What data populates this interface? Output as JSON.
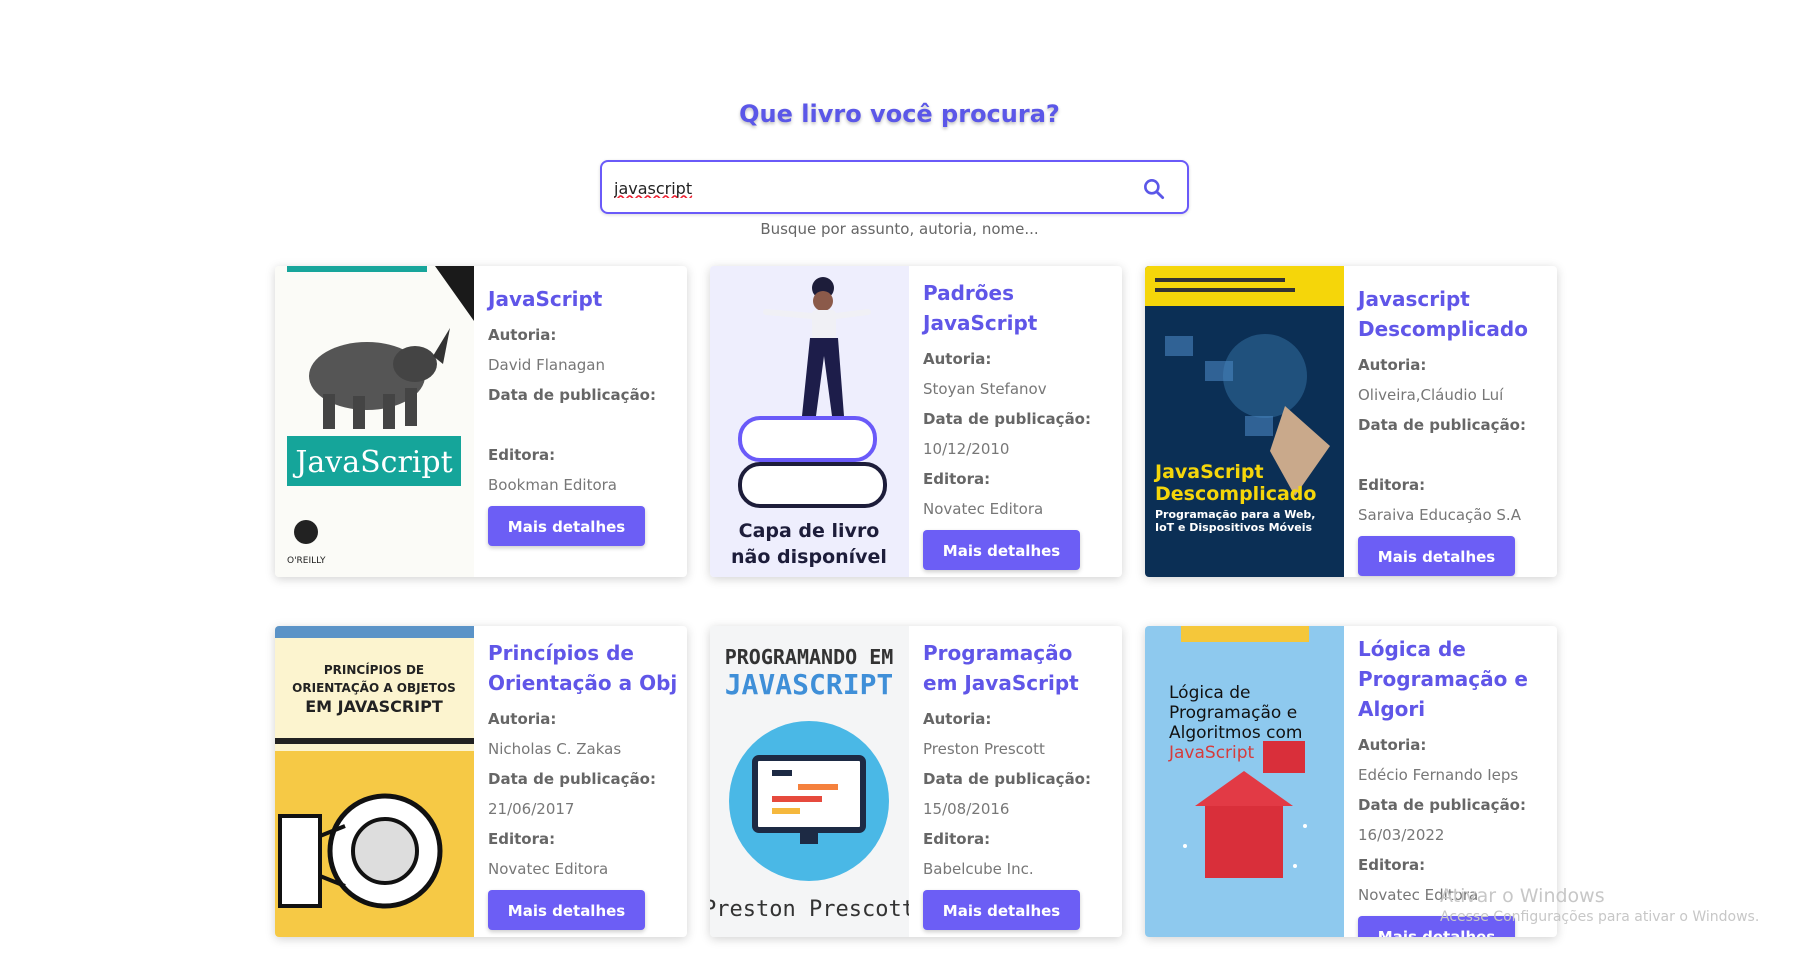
{
  "search": {
    "title": "Que livro você procura?",
    "value": "javascript",
    "hint": "Busque por assunto, autoria, nome..."
  },
  "labels": {
    "author": "Autoria:",
    "date": "Data de publicação:",
    "publisher": "Editora:",
    "button": "Mais detalhes"
  },
  "books": [
    {
      "title": "JavaScript",
      "author": "David Flanagan",
      "date": "",
      "publisher": "Bookman Editora",
      "cover": "javascript-guia-definitivo-cover"
    },
    {
      "title": "Padrões JavaScript",
      "author": "Stoyan Stefanov",
      "date": "10/12/2010",
      "publisher": "Novatec Editora",
      "cover": "placeholder-cover",
      "cover_text": "Capa de livro não disponível"
    },
    {
      "title": "Javascript Descomplicado",
      "author": "Oliveira,Cláudio Luí",
      "date": "",
      "publisher": "Saraiva Educação S.A",
      "cover": "javascript-descomplicado-cover"
    },
    {
      "title": "Princípios de Orientação a Obj",
      "author": "Nicholas C. Zakas",
      "date": "21/06/2017",
      "publisher": "Novatec Editora",
      "cover": "principios-orientacao-objetos-cover"
    },
    {
      "title": "Programação em JavaScript",
      "author": "Preston Prescott",
      "date": "15/08/2016",
      "publisher": "Babelcube Inc.",
      "cover": "programando-em-javascript-cover"
    },
    {
      "title": "Lógica de Programação e Algori",
      "author": "Edécio Fernando Ieps",
      "date": "16/03/2022",
      "publisher": "Novatec Editora",
      "cover": "logica-de-programacao-cover"
    }
  ],
  "watermark": {
    "title": "Ativar o Windows",
    "subtitle": "Acesse Configurações para ativar o Windows."
  },
  "colors": {
    "accent": "#6c5ef5",
    "title": "#6056e8"
  }
}
